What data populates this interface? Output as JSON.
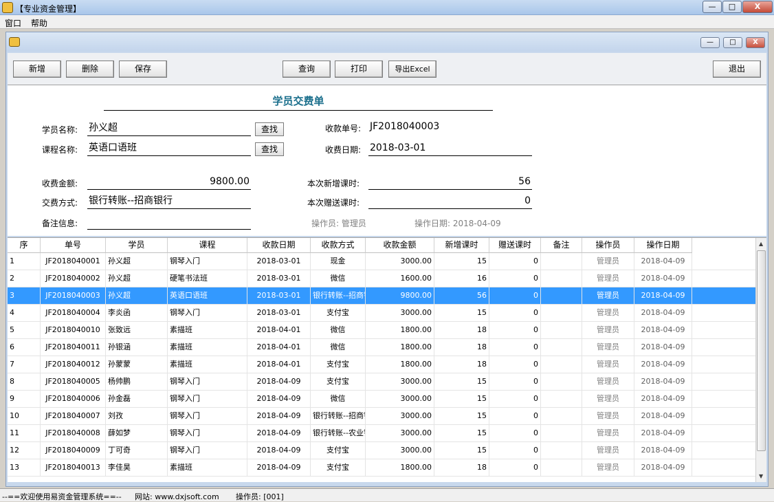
{
  "window": {
    "title": "【专业资金管理】",
    "minimize": "—",
    "maximize": "□",
    "close": "X"
  },
  "menu": [
    "窗口",
    "帮助"
  ],
  "toolbar": {
    "add": "新增",
    "delete": "删除",
    "save": "保存",
    "query": "查询",
    "print": "打印",
    "export": "导出Excel",
    "exit": "退出"
  },
  "form": {
    "title": "学员交费单",
    "student_label": "学员名称:",
    "student_value": "孙义超",
    "course_label": "课程名称:",
    "course_value": "英语口语班",
    "find_label": "查找",
    "receipt_no_label": "收款单号:",
    "receipt_no_value": "JF2018040003",
    "receipt_date_label": "收费日期:",
    "receipt_date_value": "2018-03-01",
    "amount_label": "收费金额:",
    "amount_value": "9800.00",
    "pay_method_label": "交费方式:",
    "pay_method_value": "银行转账--招商银行",
    "note_label": "备注信息:",
    "note_value": "",
    "new_hours_label": "本次新增课时:",
    "new_hours_value": "56",
    "gift_hours_label": "本次赠送课时:",
    "gift_hours_value": "0",
    "operator_text": "操作员: 管理员",
    "op_date_text": "操作日期: 2018-04-09"
  },
  "grid": {
    "headers": [
      "序",
      "单号",
      "学员",
      "课程",
      "收款日期",
      "收款方式",
      "收款金额",
      "新增课时",
      "赠送课时",
      "备注",
      "操作员",
      "操作日期"
    ],
    "rows": [
      [
        "1",
        "JF2018040001",
        "孙义超",
        "钢琴入门",
        "2018-03-01",
        "现金",
        "3000.00",
        "15",
        "0",
        "",
        "管理员",
        "2018-04-09"
      ],
      [
        "2",
        "JF2018040002",
        "孙义超",
        "硬笔书法班",
        "2018-03-01",
        "微信",
        "1600.00",
        "16",
        "0",
        "",
        "管理员",
        "2018-04-09"
      ],
      [
        "3",
        "JF2018040003",
        "孙义超",
        "英语口语班",
        "2018-03-01",
        "银行转账--招商银行",
        "9800.00",
        "56",
        "0",
        "",
        "管理员",
        "2018-04-09"
      ],
      [
        "4",
        "JF2018040004",
        "李炎函",
        "钢琴入门",
        "2018-03-01",
        "支付宝",
        "3000.00",
        "15",
        "0",
        "",
        "管理员",
        "2018-04-09"
      ],
      [
        "5",
        "JF2018040010",
        "张致远",
        "素描班",
        "2018-04-01",
        "微信",
        "1800.00",
        "18",
        "0",
        "",
        "管理员",
        "2018-04-09"
      ],
      [
        "6",
        "JF2018040011",
        "孙银涵",
        "素描班",
        "2018-04-01",
        "微信",
        "1800.00",
        "18",
        "0",
        "",
        "管理员",
        "2018-04-09"
      ],
      [
        "7",
        "JF2018040012",
        "孙蒙蒙",
        "素描班",
        "2018-04-01",
        "支付宝",
        "1800.00",
        "18",
        "0",
        "",
        "管理员",
        "2018-04-09"
      ],
      [
        "8",
        "JF2018040005",
        "杨帅鹏",
        "钢琴入门",
        "2018-04-09",
        "支付宝",
        "3000.00",
        "15",
        "0",
        "",
        "管理员",
        "2018-04-09"
      ],
      [
        "9",
        "JF2018040006",
        "孙金磊",
        "钢琴入门",
        "2018-04-09",
        "微信",
        "3000.00",
        "15",
        "0",
        "",
        "管理员",
        "2018-04-09"
      ],
      [
        "10",
        "JF2018040007",
        "刘孜",
        "钢琴入门",
        "2018-04-09",
        "银行转账--招商银行",
        "3000.00",
        "15",
        "0",
        "",
        "管理员",
        "2018-04-09"
      ],
      [
        "11",
        "JF2018040008",
        "薛如梦",
        "钢琴入门",
        "2018-04-09",
        "银行转账--农业银行",
        "3000.00",
        "15",
        "0",
        "",
        "管理员",
        "2018-04-09"
      ],
      [
        "12",
        "JF2018040009",
        "丁可奇",
        "钢琴入门",
        "2018-04-09",
        "支付宝",
        "3000.00",
        "15",
        "0",
        "",
        "管理员",
        "2018-04-09"
      ],
      [
        "13",
        "JF2018040013",
        "李佳昊",
        "素描班",
        "2018-04-09",
        "支付宝",
        "1800.00",
        "18",
        "0",
        "",
        "管理员",
        "2018-04-09"
      ]
    ],
    "selected_row": 3,
    "colors": {
      "selection": "#3399ff",
      "operator_text": "#808080"
    }
  },
  "status": {
    "welcome": "--==欢迎使用易资金管理系统==--",
    "website": "网站: www.dxjsoft.com",
    "operator": "操作员: [001]"
  }
}
